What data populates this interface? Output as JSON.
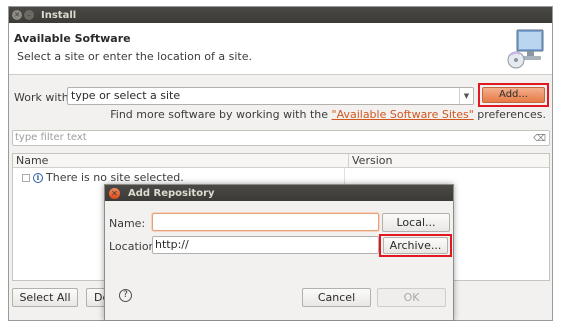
{
  "window": {
    "title": "Install",
    "close_icon": "close-icon",
    "minimize_icon": "minimize-icon"
  },
  "header": {
    "heading": "Available Software",
    "subheading": "Select a site or enter the location of a site.",
    "icon": "install-wizard-monitor-icon"
  },
  "work_with": {
    "label": "Work with:",
    "combo_value": "type or select a site",
    "add_label": "Add...",
    "highlight_color": "#e0181f"
  },
  "find_more": {
    "prefix": "Find more software by working with the ",
    "link": "\"Available Software Sites\"",
    "suffix": " preferences."
  },
  "filter": {
    "placeholder": "type filter text"
  },
  "table": {
    "columns": [
      "Name",
      "Version"
    ],
    "rows": [
      {
        "name": "There is no site selected."
      }
    ]
  },
  "footer": {
    "select_all": "Select All",
    "deselect_all": "Deselect All"
  },
  "dialog": {
    "title": "Add Repository",
    "name_label": "Name:",
    "name_value": "",
    "location_label": "Location:",
    "location_value": "http://",
    "local_label": "Local...",
    "archive_label": "Archive...",
    "cancel_label": "Cancel",
    "ok_label": "OK",
    "accent_color": "#e05a22"
  }
}
